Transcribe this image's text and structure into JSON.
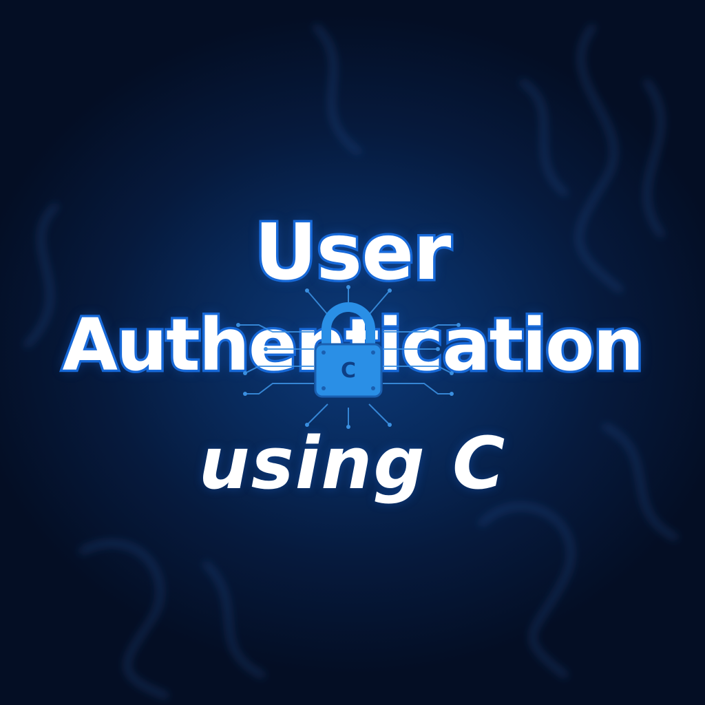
{
  "title": {
    "line1": "User",
    "line2": "Authentication",
    "line3": "using C"
  },
  "emblem": {
    "icon": "padlock-icon",
    "glyph": "C"
  },
  "colors": {
    "background": "#06122a",
    "glow": "#0c3a7a",
    "accent": "#1769d6",
    "lock": "#2a8fe6",
    "text": "#ffffff"
  }
}
